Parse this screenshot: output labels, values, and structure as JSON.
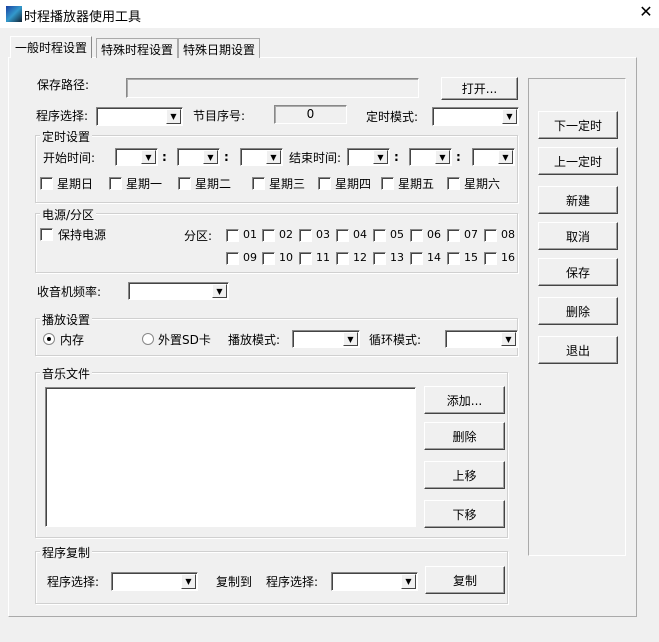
{
  "window": {
    "title": "时程播放器使用工具",
    "close": "✕"
  },
  "tabs": [
    "一般时程设置",
    "特殊时程设置",
    "特殊日期设置"
  ],
  "save_path": {
    "label": "保存路径:",
    "value": "",
    "open": "打开..."
  },
  "program_select_label": "程序选择:",
  "item_no": {
    "label": "节目序号:",
    "value": "0"
  },
  "timer_mode_label": "定时模式:",
  "timer": {
    "title": "定时设置",
    "start": "开始时间:",
    "end": "结束时间:",
    "colon": ":",
    "weekdays": [
      "星期日",
      "星期一",
      "星期二",
      "星期三",
      "星期四",
      "星期五",
      "星期六"
    ]
  },
  "power": {
    "title": "电源/分区",
    "keep": "保持电源",
    "zone_label": "分区:",
    "zones": [
      "01",
      "02",
      "03",
      "04",
      "05",
      "06",
      "07",
      "08",
      "09",
      "10",
      "11",
      "12",
      "13",
      "14",
      "15",
      "16"
    ]
  },
  "radio_freq_label": "收音机频率:",
  "play": {
    "title": "播放设置",
    "internal": "内存",
    "sd": "外置SD卡",
    "play_mode": "播放模式:",
    "loop_mode": "循环模式:"
  },
  "music": {
    "title": "音乐文件",
    "add": "添加...",
    "delete": "删除",
    "up": "上移",
    "down": "下移"
  },
  "copy": {
    "title": "程序复制",
    "from": "程序选择:",
    "to": "复制到",
    "to_select": "程序选择:",
    "button": "复制"
  },
  "side": [
    "下一定时",
    "上一定时",
    "新建",
    "取消",
    "保存",
    "删除",
    "退出"
  ]
}
